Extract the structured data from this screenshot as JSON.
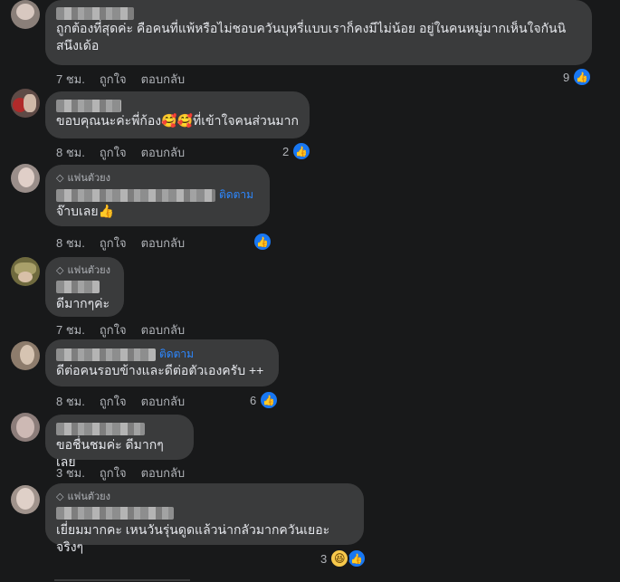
{
  "comments": [
    {
      "text": "ถูกต้องที่สุดค่ะ คือคนที่แพ้หรือไม่ชอบควันบุหรี่แบบเราก็คงมีไม่น้อย อยู่ในคนหมู่มากเห็นใจกันนิ\nสนึงเด้อ",
      "time": "7 ชม.",
      "like": "ถูกใจ",
      "reply": "ตอบกลับ",
      "reaction_count": "9"
    },
    {
      "text": "ขอบคุณนะค่ะพี่ก้อง",
      "emoji": "🥰🥰",
      "text_after": "ที่เข้าใจคนส่วนมาก",
      "time": "8 ชม.",
      "like": "ถูกใจ",
      "reply": "ตอบกลับ",
      "reaction_count": "2"
    },
    {
      "badge": "แฟนตัวยง",
      "follow": "ติดตาม",
      "text": "จ๊าบเลย",
      "emoji": "👍",
      "time": "8 ชม.",
      "like": "ถูกใจ",
      "reply": "ตอบกลับ",
      "reaction_count": ""
    },
    {
      "badge": "แฟนตัวยง",
      "text": "ดีมากๆค่ะ",
      "time": "7 ชม.",
      "like": "ถูกใจ",
      "reply": "ตอบกลับ"
    },
    {
      "follow": "ติดตาม",
      "text": "ดีต่อคนรอบข้างและดีต่อตัวเองครับ ++",
      "time": "8 ชม.",
      "like": "ถูกใจ",
      "reply": "ตอบกลับ",
      "reaction_count": "6"
    },
    {
      "text": "ขอชื่นชมค่ะ ดีมากๆเลย",
      "time": "3 ชม.",
      "like": "ถูกใจ",
      "reply": "ตอบกลับ"
    },
    {
      "badge": "แฟนตัวยง",
      "text": "เยี่ยมมากคะ เหนวันรุ่นดูดแล้วน่ากลัวมากควันเยอะจริงๆ",
      "time": "",
      "like": "",
      "reply": "",
      "reaction_count": "3"
    }
  ],
  "colors": {
    "background": "#18191a",
    "bubble": "#3a3b3c",
    "text": "#e4e6eb",
    "secondary": "#b0b3b8",
    "link": "#2d88ff",
    "like": "#1877f2"
  }
}
